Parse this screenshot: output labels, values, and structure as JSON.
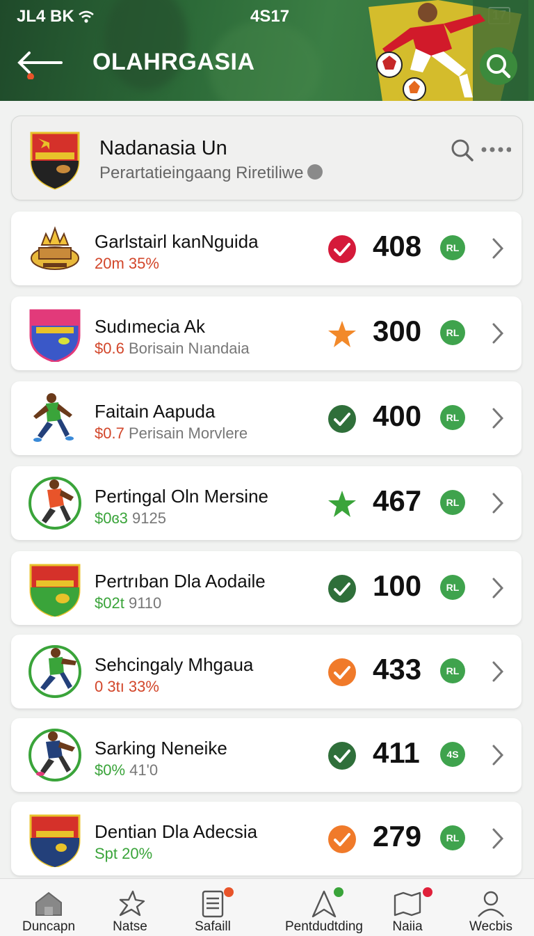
{
  "status_bar": {
    "left": "JL4 BK",
    "time": "4S17",
    "right": "17"
  },
  "header": {
    "title": "OLAHRGASIA"
  },
  "league": {
    "name": "Nadanasia Un",
    "subtitle": "Perartatieingaang  Riretiliwe"
  },
  "teams": [
    {
      "name": "Garlstairl kanNguida",
      "sub_a": "20m 35%",
      "sub_b": "",
      "sub_color": "#d2462a",
      "status_icon": "check-circle-icon",
      "status_color": "#d51a3a",
      "score": "408",
      "pill": "RL"
    },
    {
      "name": "Sudımecia Ak",
      "sub_a": "$0.6",
      "sub_b": "Borisain Nıandaia",
      "sub_color": "#d2462a",
      "status_icon": "star-icon",
      "status_color": "#f2892a",
      "score": "300",
      "pill": "RL"
    },
    {
      "name": "Faitain Aapuda",
      "sub_a": "$0.7",
      "sub_b": "Perisain Morvlere",
      "sub_color": "#d2462a",
      "status_icon": "check-circle-icon",
      "status_color": "#2f6f3a",
      "score": "400",
      "pill": "RL"
    },
    {
      "name": "Pertingal Oln Mersine",
      "sub_a": "$0ɞ3",
      "sub_b": "9125",
      "sub_color": "#3aa43a",
      "status_icon": "star-icon",
      "status_color": "#3aa43a",
      "score": "467",
      "pill": "RL"
    },
    {
      "name": "Pertrıban Dla Aodaile",
      "sub_a": "$02t",
      "sub_b": "9110",
      "sub_color": "#3aa43a",
      "status_icon": "check-circle-icon",
      "status_color": "#2f6f3a",
      "score": "100",
      "pill": "RL"
    },
    {
      "name": "Sehcingaly Mhgaua",
      "sub_a": "0 3tı 33%",
      "sub_b": "",
      "sub_color": "#d2462a",
      "status_icon": "check-circle-icon",
      "status_color": "#f07a2a",
      "score": "433",
      "pill": "RL"
    },
    {
      "name": "Sarking Neneike",
      "sub_a": "$0%",
      "sub_b": "41'0",
      "sub_color": "#3aa43a",
      "status_icon": "check-circle-icon",
      "status_color": "#2f6f3a",
      "score": "411",
      "pill": "4S"
    },
    {
      "name": "Dentian Dla Adecsia",
      "sub_a": "Spt 20%",
      "sub_b": "",
      "sub_color": "#3aa43a",
      "status_icon": "check-circle-icon",
      "status_color": "#f07a2a",
      "score": "279",
      "pill": "RL"
    }
  ],
  "nav": [
    {
      "label": "Duncapn",
      "icon": "home-icon"
    },
    {
      "label": "Natse",
      "icon": "pin-icon"
    },
    {
      "label": "Safaill",
      "icon": "document-icon"
    },
    {
      "label": "Pentdudtding",
      "icon": "navigate-icon"
    },
    {
      "label": "Naiia",
      "icon": "map-icon"
    },
    {
      "label": "Wecbis",
      "icon": "profile-icon"
    }
  ],
  "colors": {
    "header_green": "#2c6a38",
    "accent_green": "#3fa34d",
    "alert_red": "#d51a3a",
    "orange": "#f07a2a"
  }
}
